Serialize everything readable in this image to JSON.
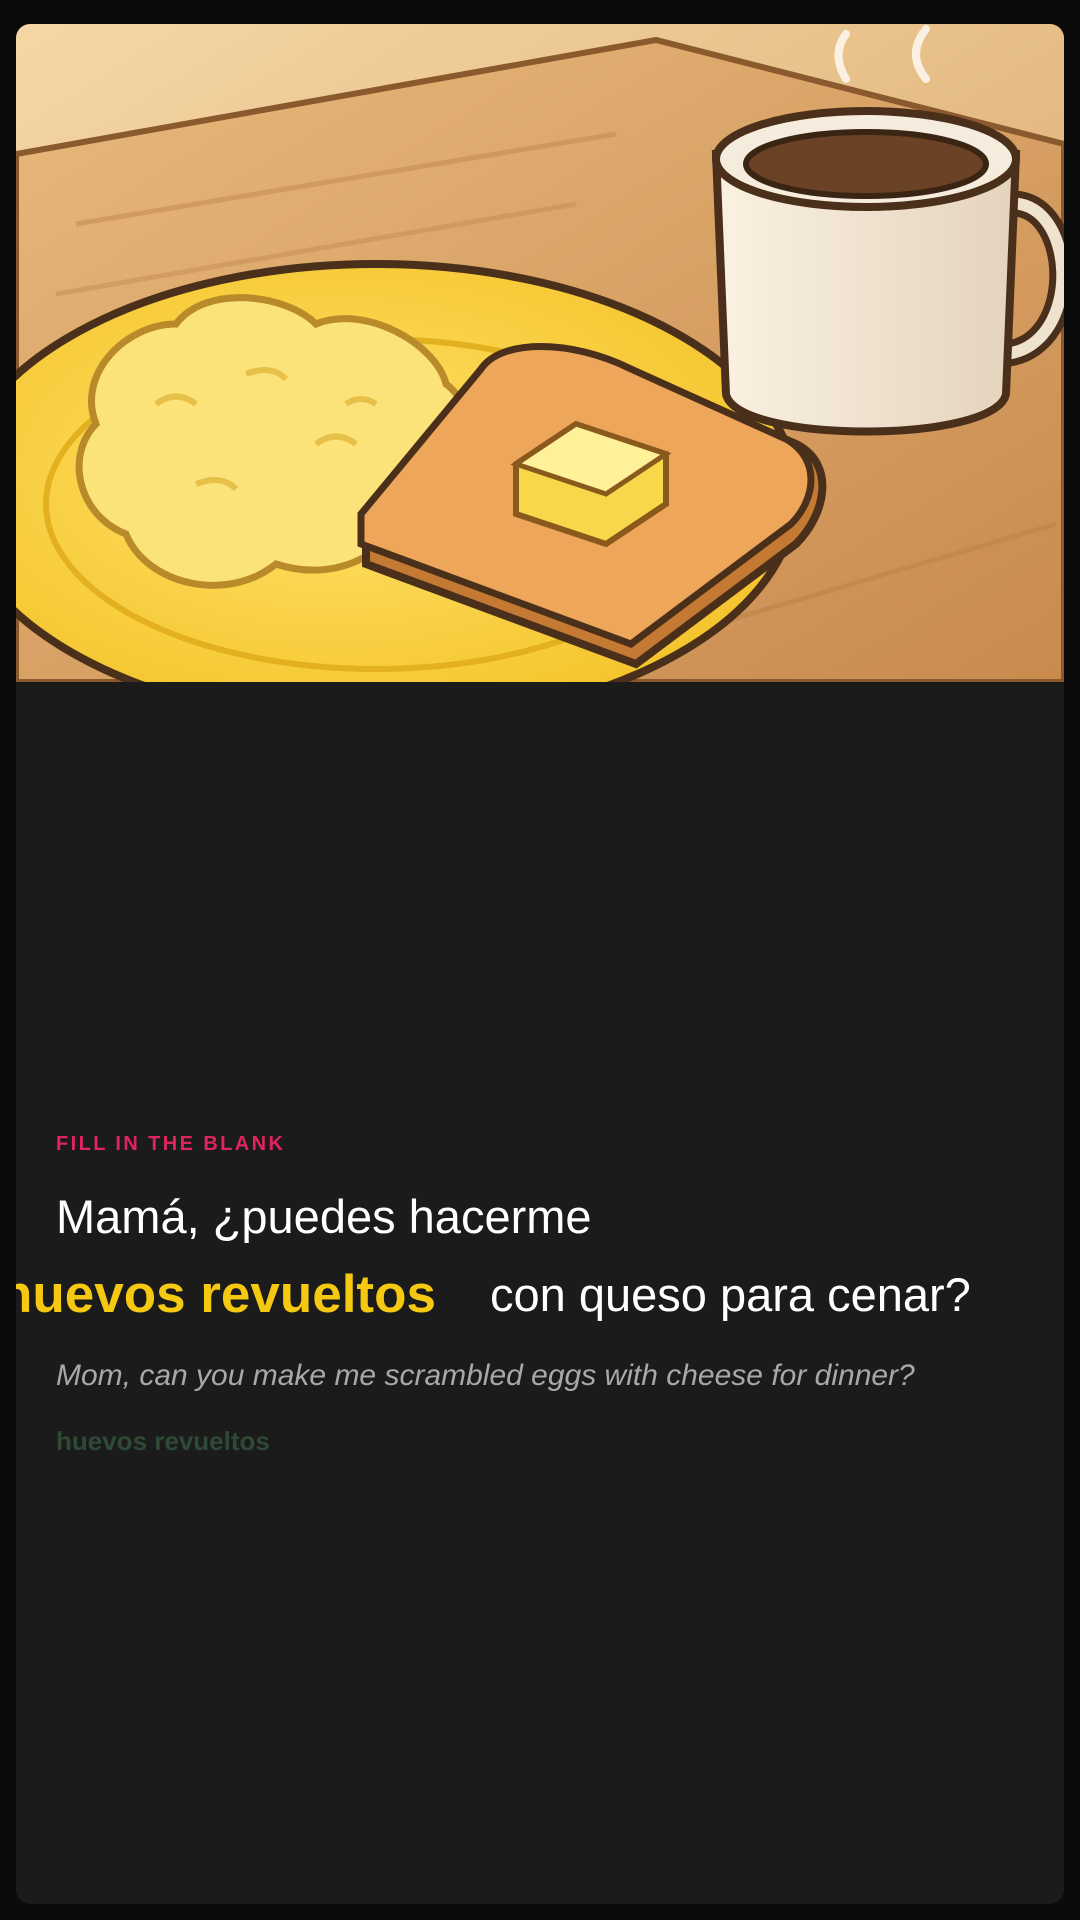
{
  "card": {
    "illustration": {
      "description": "breakfast illustration",
      "icons": [
        "plate-icon",
        "scrambled-eggs-icon",
        "toast-icon",
        "butter-icon",
        "coffee-mug-icon",
        "steam-icon"
      ]
    },
    "kicker": "FILL IN THE BLANK",
    "sentence": {
      "before": "Mamá, ¿puedes hacerme",
      "answer": "huevos revueltos",
      "after": "con queso para cenar?"
    },
    "translation": "Mom, can you make me scrambled eggs with cheese for dinner?",
    "hint": "huevos revueltos"
  },
  "colors": {
    "page_bg": "#0b0b0b",
    "card_bg": "#1b1b1b",
    "kicker": "#e0245e",
    "answer": "#f5c912",
    "translation": "#a8a8a8",
    "hint": "#2e4a36"
  }
}
